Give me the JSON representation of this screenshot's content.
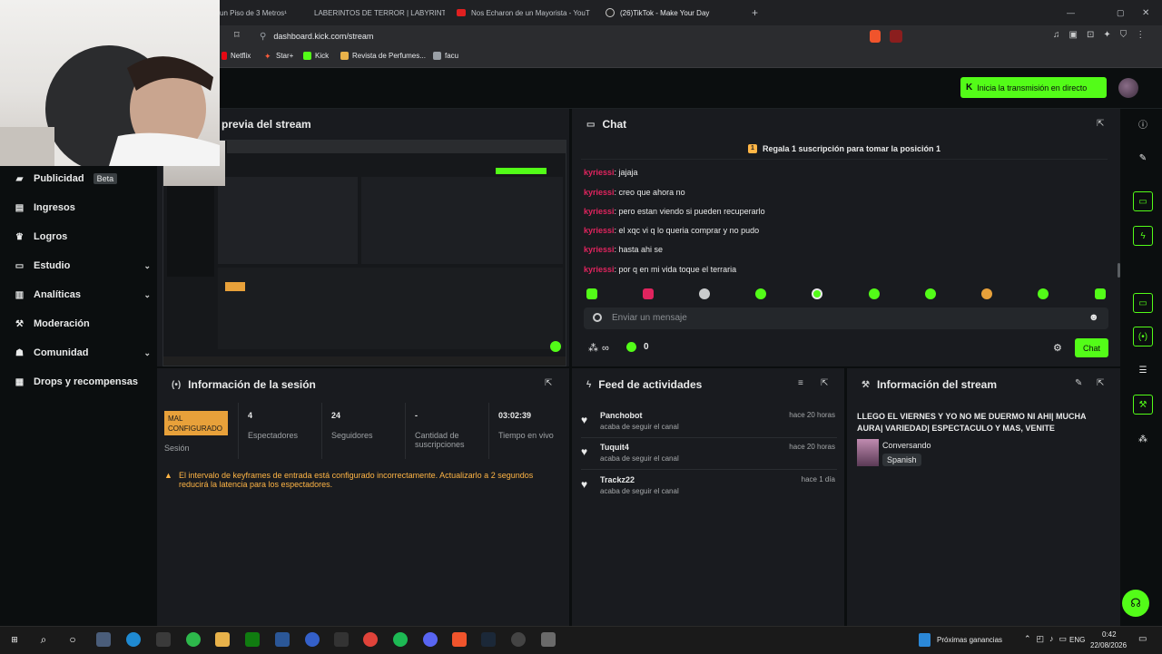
{
  "browser": {
    "tabs": [
      {
        "label": "un Piso de 3 Metros¹"
      },
      {
        "label": "LABERINTOS DE TERROR | LABYRINT"
      },
      {
        "label": "Nos Echaron de un Mayorista - YouT"
      },
      {
        "label": "(26)TikTok - Make Your Day"
      }
    ],
    "new_tab": "+",
    "url": "dashboard.kick.com/stream",
    "bookmarks": [
      "Netflix",
      "Star+",
      "Kick",
      "Revista de Perfumes...",
      "facu"
    ]
  },
  "header": {
    "go_live_label": "Inicia la transmisión en directo"
  },
  "sidebar": {
    "items": [
      {
        "label": "Publicidad",
        "badge": "Beta"
      },
      {
        "label": "Ingresos"
      },
      {
        "label": "Logros"
      },
      {
        "label": "Estudio"
      },
      {
        "label": "Analíticas"
      },
      {
        "label": "Moderación"
      },
      {
        "label": "Comunidad"
      },
      {
        "label": "Drops y recompensas"
      }
    ]
  },
  "preview": {
    "title": "previa del stream"
  },
  "chat": {
    "title": "Chat",
    "banner": "Regala 1 suscripción para tomar la posición 1",
    "messages": [
      {
        "user": "kyriessi",
        "text": ": jajaja"
      },
      {
        "user": "kyriessi",
        "text": ": creo que ahora no"
      },
      {
        "user": "kyriessi",
        "text": ": pero estan viendo si pueden recuperarlo"
      },
      {
        "user": "kyriessi",
        "text": ": el xqc vi q lo queria comprar y no pudo"
      },
      {
        "user": "kyriessi",
        "text": ": hasta ahi se"
      },
      {
        "user": "kyriessi",
        "text": ": por q en mi vida toque el terraria"
      }
    ],
    "input_placeholder": "Enviar un mensaje",
    "infinity": "∞",
    "points": "0",
    "send_label": "Chat"
  },
  "session": {
    "title": "Información de la sesión",
    "badge": "MAL CONFIGURADO",
    "badge_label": "Sesión",
    "stats": [
      {
        "value": "4",
        "label": "Espectadores"
      },
      {
        "value": "24",
        "label": "Seguidores"
      },
      {
        "value": "-",
        "label": "Cantidad de suscripciones"
      },
      {
        "value": "03:02:39",
        "label": "Tiempo en vivo"
      }
    ],
    "warning": "El intervalo de keyframes de entrada está configurado incorrectamente. Actualizarlo a 2 segundos reducirá la latencia para los espectadores."
  },
  "feed": {
    "title": "Feed de actividades",
    "items": [
      {
        "name": "Panchobot",
        "action": "acaba de seguir el canal",
        "time": "hace 20 horas"
      },
      {
        "name": "Tuquit4",
        "action": "acaba de seguir el canal",
        "time": "hace 20 horas"
      },
      {
        "name": "Trackz22",
        "action": "acaba de seguir el canal",
        "time": "hace 1 día"
      }
    ]
  },
  "stream_info": {
    "title": "Información del stream",
    "stream_title": "LLEGO EL VIERNES Y YO NO ME DUERMO NI AHI| MUCHA AURA| VARIEDAD| ESPECTACULO Y MAS, VENITE",
    "category": "Conversando",
    "language": "Spanish"
  },
  "taskbar": {
    "earnings_label": "Próximas ganancias",
    "lang": "ENG",
    "time": "0:42",
    "date": "22/08/2026"
  },
  "colors": {
    "accent": "#53fc18",
    "username": "#e0245e",
    "warning": "#ffb545",
    "panel": "#191b1f",
    "bg": "#0b0e0f"
  }
}
